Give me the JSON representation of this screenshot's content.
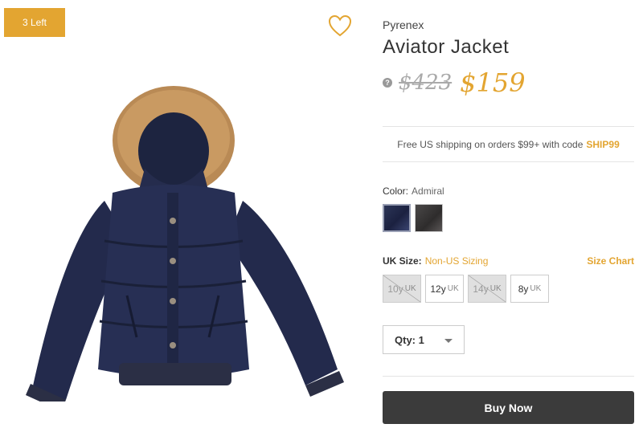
{
  "product": {
    "stock_badge": "3 Left",
    "brand": "Pyrenex",
    "title": "Aviator Jacket",
    "old_price": "$423",
    "new_price": "$159",
    "help_glyph": "?"
  },
  "shipping": {
    "text": "Free US shipping on orders $99+ with code",
    "code": "SHIP99"
  },
  "color": {
    "label": "Color:",
    "value": "Admiral",
    "swatches": [
      "navy",
      "charcoal"
    ]
  },
  "size": {
    "label": "UK Size:",
    "non_us": "Non-US Sizing",
    "chart_link": "Size Chart",
    "options": [
      {
        "value": "10y",
        "unit": "UK",
        "available": false
      },
      {
        "value": "12y",
        "unit": "UK",
        "available": true
      },
      {
        "value": "14y",
        "unit": "UK",
        "available": false
      },
      {
        "value": "8y",
        "unit": "UK",
        "available": true
      }
    ]
  },
  "quantity": {
    "label": "Qty: 1"
  },
  "actions": {
    "buy_label": "Buy Now"
  },
  "colors": {
    "accent": "#e3a531",
    "button": "#3b3b3b"
  },
  "icons": [
    "heart-icon",
    "help-icon",
    "chevron-down-icon"
  ]
}
